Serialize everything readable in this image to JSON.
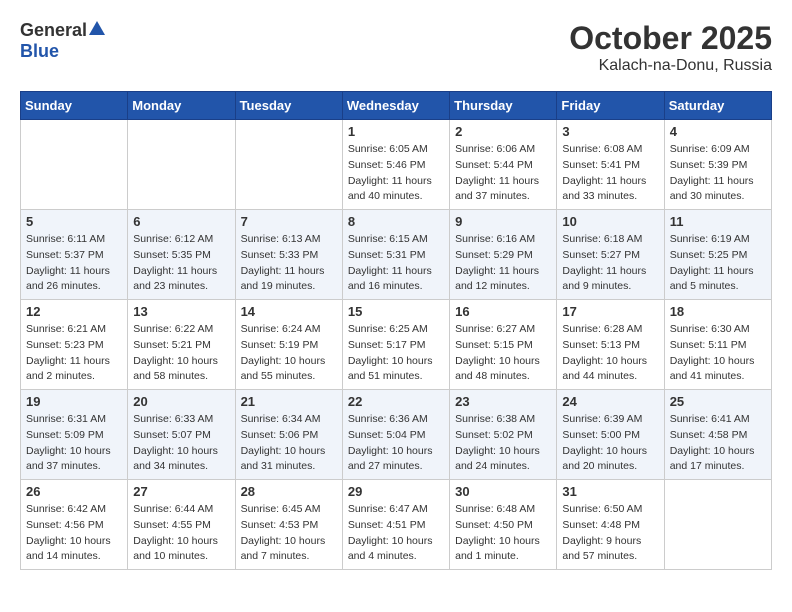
{
  "header": {
    "logo_general": "General",
    "logo_blue": "Blue",
    "month": "October 2025",
    "location": "Kalach-na-Donu, Russia"
  },
  "days_of_week": [
    "Sunday",
    "Monday",
    "Tuesday",
    "Wednesday",
    "Thursday",
    "Friday",
    "Saturday"
  ],
  "weeks": [
    [
      {
        "day": "",
        "info": ""
      },
      {
        "day": "",
        "info": ""
      },
      {
        "day": "",
        "info": ""
      },
      {
        "day": "1",
        "info": "Sunrise: 6:05 AM\nSunset: 5:46 PM\nDaylight: 11 hours\nand 40 minutes."
      },
      {
        "day": "2",
        "info": "Sunrise: 6:06 AM\nSunset: 5:44 PM\nDaylight: 11 hours\nand 37 minutes."
      },
      {
        "day": "3",
        "info": "Sunrise: 6:08 AM\nSunset: 5:41 PM\nDaylight: 11 hours\nand 33 minutes."
      },
      {
        "day": "4",
        "info": "Sunrise: 6:09 AM\nSunset: 5:39 PM\nDaylight: 11 hours\nand 30 minutes."
      }
    ],
    [
      {
        "day": "5",
        "info": "Sunrise: 6:11 AM\nSunset: 5:37 PM\nDaylight: 11 hours\nand 26 minutes."
      },
      {
        "day": "6",
        "info": "Sunrise: 6:12 AM\nSunset: 5:35 PM\nDaylight: 11 hours\nand 23 minutes."
      },
      {
        "day": "7",
        "info": "Sunrise: 6:13 AM\nSunset: 5:33 PM\nDaylight: 11 hours\nand 19 minutes."
      },
      {
        "day": "8",
        "info": "Sunrise: 6:15 AM\nSunset: 5:31 PM\nDaylight: 11 hours\nand 16 minutes."
      },
      {
        "day": "9",
        "info": "Sunrise: 6:16 AM\nSunset: 5:29 PM\nDaylight: 11 hours\nand 12 minutes."
      },
      {
        "day": "10",
        "info": "Sunrise: 6:18 AM\nSunset: 5:27 PM\nDaylight: 11 hours\nand 9 minutes."
      },
      {
        "day": "11",
        "info": "Sunrise: 6:19 AM\nSunset: 5:25 PM\nDaylight: 11 hours\nand 5 minutes."
      }
    ],
    [
      {
        "day": "12",
        "info": "Sunrise: 6:21 AM\nSunset: 5:23 PM\nDaylight: 11 hours\nand 2 minutes."
      },
      {
        "day": "13",
        "info": "Sunrise: 6:22 AM\nSunset: 5:21 PM\nDaylight: 10 hours\nand 58 minutes."
      },
      {
        "day": "14",
        "info": "Sunrise: 6:24 AM\nSunset: 5:19 PM\nDaylight: 10 hours\nand 55 minutes."
      },
      {
        "day": "15",
        "info": "Sunrise: 6:25 AM\nSunset: 5:17 PM\nDaylight: 10 hours\nand 51 minutes."
      },
      {
        "day": "16",
        "info": "Sunrise: 6:27 AM\nSunset: 5:15 PM\nDaylight: 10 hours\nand 48 minutes."
      },
      {
        "day": "17",
        "info": "Sunrise: 6:28 AM\nSunset: 5:13 PM\nDaylight: 10 hours\nand 44 minutes."
      },
      {
        "day": "18",
        "info": "Sunrise: 6:30 AM\nSunset: 5:11 PM\nDaylight: 10 hours\nand 41 minutes."
      }
    ],
    [
      {
        "day": "19",
        "info": "Sunrise: 6:31 AM\nSunset: 5:09 PM\nDaylight: 10 hours\nand 37 minutes."
      },
      {
        "day": "20",
        "info": "Sunrise: 6:33 AM\nSunset: 5:07 PM\nDaylight: 10 hours\nand 34 minutes."
      },
      {
        "day": "21",
        "info": "Sunrise: 6:34 AM\nSunset: 5:06 PM\nDaylight: 10 hours\nand 31 minutes."
      },
      {
        "day": "22",
        "info": "Sunrise: 6:36 AM\nSunset: 5:04 PM\nDaylight: 10 hours\nand 27 minutes."
      },
      {
        "day": "23",
        "info": "Sunrise: 6:38 AM\nSunset: 5:02 PM\nDaylight: 10 hours\nand 24 minutes."
      },
      {
        "day": "24",
        "info": "Sunrise: 6:39 AM\nSunset: 5:00 PM\nDaylight: 10 hours\nand 20 minutes."
      },
      {
        "day": "25",
        "info": "Sunrise: 6:41 AM\nSunset: 4:58 PM\nDaylight: 10 hours\nand 17 minutes."
      }
    ],
    [
      {
        "day": "26",
        "info": "Sunrise: 6:42 AM\nSunset: 4:56 PM\nDaylight: 10 hours\nand 14 minutes."
      },
      {
        "day": "27",
        "info": "Sunrise: 6:44 AM\nSunset: 4:55 PM\nDaylight: 10 hours\nand 10 minutes."
      },
      {
        "day": "28",
        "info": "Sunrise: 6:45 AM\nSunset: 4:53 PM\nDaylight: 10 hours\nand 7 minutes."
      },
      {
        "day": "29",
        "info": "Sunrise: 6:47 AM\nSunset: 4:51 PM\nDaylight: 10 hours\nand 4 minutes."
      },
      {
        "day": "30",
        "info": "Sunrise: 6:48 AM\nSunset: 4:50 PM\nDaylight: 10 hours\nand 1 minute."
      },
      {
        "day": "31",
        "info": "Sunrise: 6:50 AM\nSunset: 4:48 PM\nDaylight: 9 hours\nand 57 minutes."
      },
      {
        "day": "",
        "info": ""
      }
    ]
  ]
}
